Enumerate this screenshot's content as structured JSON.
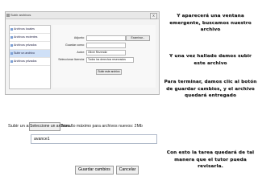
{
  "window": {
    "title": "Subir archivos",
    "close_label": "x",
    "sidebar": {
      "items": [
        {
          "label": "Archivos locales"
        },
        {
          "label": "Archivos recientes"
        },
        {
          "label": "Archivos privados"
        },
        {
          "label": "Subir un archivo"
        },
        {
          "label": "Archivos privados"
        }
      ],
      "active_index": 3
    },
    "form": {
      "adjunto_label": "Adjunto:",
      "examinar_label": "Examinar...",
      "guardar_como_label": "Guardar como:",
      "autor_label": "Autor:",
      "autor_value": "Oliver Rezendiz",
      "seleccionar_licencia_label": "Seleccionar licencia:",
      "licencia_value": "Todos los derechos reservados",
      "subir_button": "Subir este archivo"
    }
  },
  "notes": [
    "Y aparecerá una ventana emergente, buscamos nuestro archivo",
    "Y una vez hallado damos subir este archivo",
    "Para terminar, damos clic al botón de guardar cambios, y el archivo quedará entregado",
    "Con esto la tarea quedará de tal manera que el tutor pueda revisarla."
  ],
  "upload": {
    "label": "Subir un archivo:",
    "button_label": "Seleccione un archivo...",
    "hint": "Tamaño máximo para archivos nuevos: 2Mb",
    "filename": "avance1",
    "save_label": "Guardar cambios",
    "cancel_label": "Cancelar"
  }
}
